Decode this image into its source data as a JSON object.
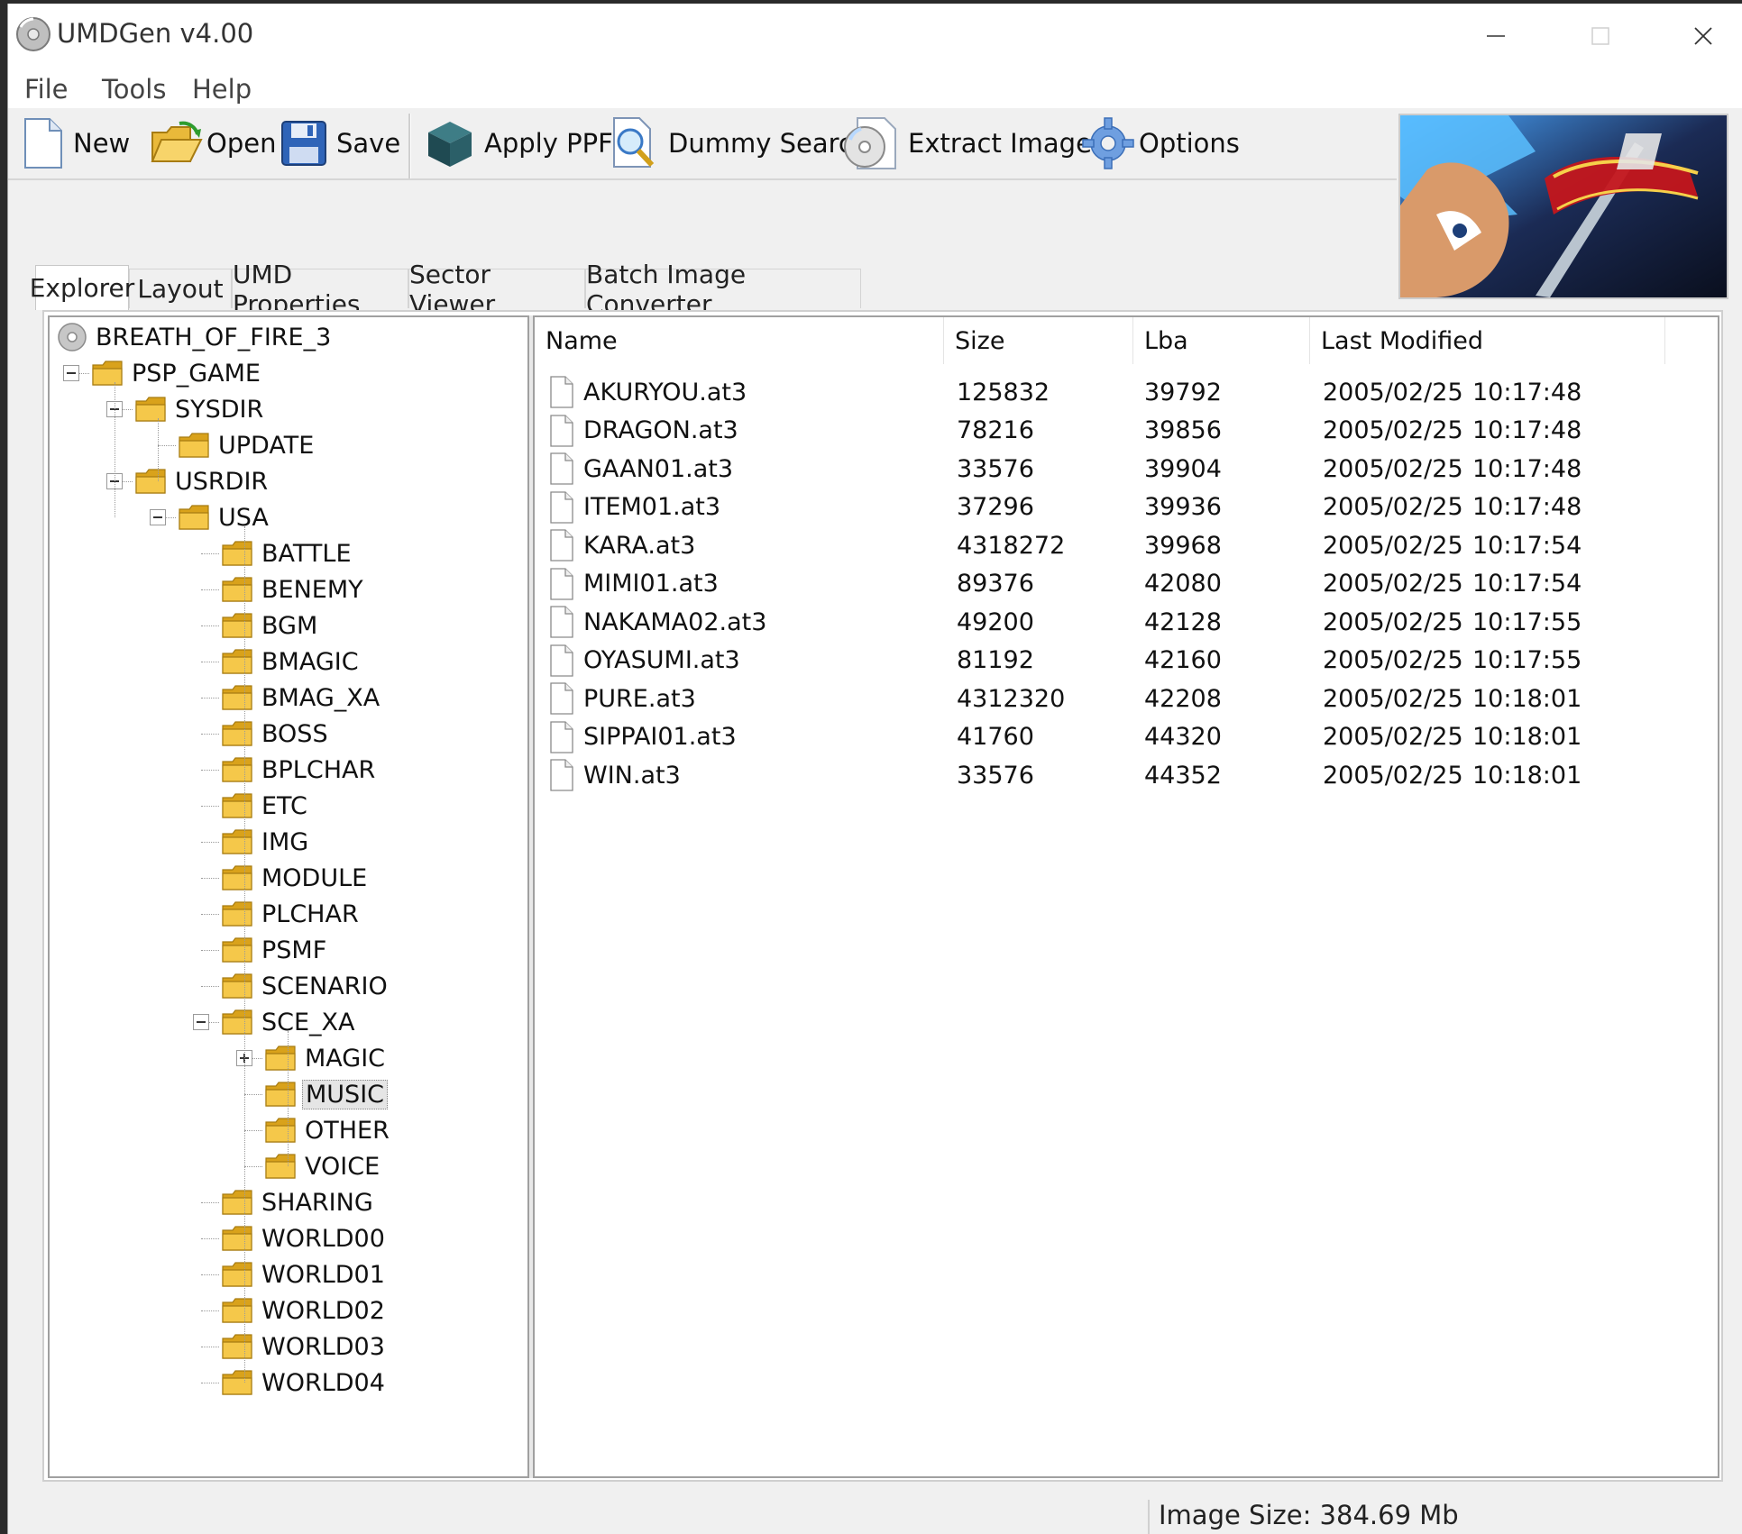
{
  "window": {
    "title": "UMDGen v4.00"
  },
  "menu": [
    "File",
    "Tools",
    "Help"
  ],
  "toolbar": {
    "new_label": "New",
    "open_label": "Open",
    "save_label": "Save",
    "apply_ppf_label": "Apply PPF",
    "dummy_search_label": "Dummy Search",
    "extract_image_label": "Extract Image",
    "options_label": "Options"
  },
  "tabs": [
    "Explorer",
    "Layout",
    "UMD Properties",
    "Sector Viewer",
    "Batch Image Converter"
  ],
  "tree": {
    "root": "BREATH_OF_FIRE_3",
    "nodes": [
      "PSP_GAME",
      "SYSDIR",
      "UPDATE",
      "USRDIR",
      "USA",
      "BATTLE",
      "BENEMY",
      "BGM",
      "BMAGIC",
      "BMAG_XA",
      "BOSS",
      "BPLCHAR",
      "ETC",
      "IMG",
      "MODULE",
      "PLCHAR",
      "PSMF",
      "SCENARIO",
      "SCE_XA",
      "MAGIC",
      "MUSIC",
      "OTHER",
      "VOICE",
      "SHARING",
      "WORLD00",
      "WORLD01",
      "WORLD02",
      "WORLD03",
      "WORLD04"
    ]
  },
  "list": {
    "columns": [
      "Name",
      "Size",
      "Lba",
      "Last Modified"
    ],
    "rows": [
      {
        "name": "AKURYOU.at3",
        "size": "125832",
        "lba": "39792",
        "date": "2005/02/25",
        "time": "10:17:48"
      },
      {
        "name": "DRAGON.at3",
        "size": "78216",
        "lba": "39856",
        "date": "2005/02/25",
        "time": "10:17:48"
      },
      {
        "name": "GAAN01.at3",
        "size": "33576",
        "lba": "39904",
        "date": "2005/02/25",
        "time": "10:17:48"
      },
      {
        "name": "ITEM01.at3",
        "size": "37296",
        "lba": "39936",
        "date": "2005/02/25",
        "time": "10:17:48"
      },
      {
        "name": "KARA.at3",
        "size": "4318272",
        "lba": "39968",
        "date": "2005/02/25",
        "time": "10:17:54"
      },
      {
        "name": "MIMI01.at3",
        "size": "89376",
        "lba": "42080",
        "date": "2005/02/25",
        "time": "10:17:54"
      },
      {
        "name": "NAKAMA02.at3",
        "size": "49200",
        "lba": "42128",
        "date": "2005/02/25",
        "time": "10:17:55"
      },
      {
        "name": "OYASUMI.at3",
        "size": "81192",
        "lba": "42160",
        "date": "2005/02/25",
        "time": "10:17:55"
      },
      {
        "name": "PURE.at3",
        "size": "4312320",
        "lba": "42208",
        "date": "2005/02/25",
        "time": "10:18:01"
      },
      {
        "name": "SIPPAI01.at3",
        "size": "41760",
        "lba": "44320",
        "date": "2005/02/25",
        "time": "10:18:01"
      },
      {
        "name": "WIN.at3",
        "size": "33576",
        "lba": "44352",
        "date": "2005/02/25",
        "time": "10:18:01"
      }
    ]
  },
  "status": {
    "image_size": "Image Size: 384.69 Mb"
  },
  "colors": {
    "folder": "#f5c84a",
    "folder_dark": "#d9a21b",
    "selected_bg": "#e5e5e5"
  },
  "icons": {
    "app": "disc-icon",
    "new": "new-file-icon",
    "open": "open-folder-icon",
    "save": "floppy-disk-icon",
    "apply_ppf": "cube-icon",
    "dummy_search": "magnifier-document-icon",
    "extract_image": "cd-disc-icon",
    "options": "gear-icon"
  }
}
